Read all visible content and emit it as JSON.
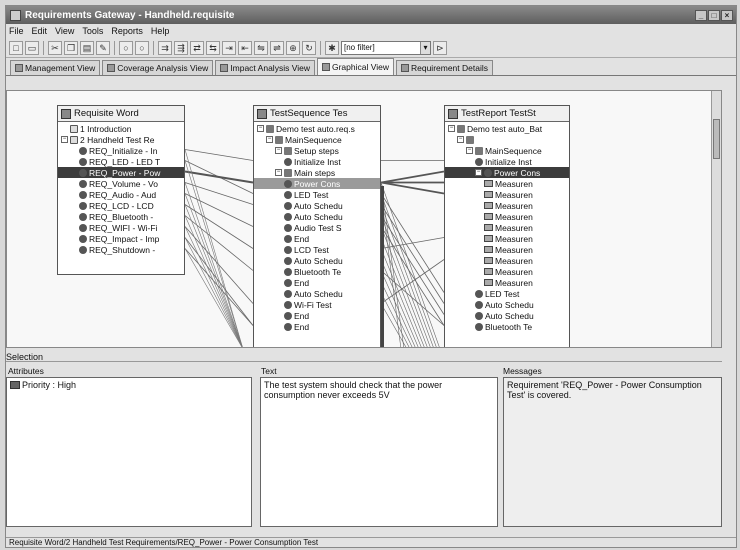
{
  "window": {
    "title": "Requirements Gateway - Handheld.requisite",
    "controls": [
      "_",
      "□",
      "×"
    ]
  },
  "menu": [
    "File",
    "Edit",
    "View",
    "Tools",
    "Reports",
    "Help"
  ],
  "toolbar": {
    "filter_value": "[no filter]"
  },
  "tabs": [
    {
      "label": "Management View"
    },
    {
      "label": "Coverage Analysis View"
    },
    {
      "label": "Impact Analysis View"
    },
    {
      "label": "Graphical View"
    },
    {
      "label": "Requirement Details"
    }
  ],
  "panels": {
    "requisite": {
      "header": "Requisite   Word",
      "rows": [
        {
          "label": "1 Introduction",
          "indent": 1,
          "icon": "doc",
          "state": ""
        },
        {
          "label": "2 Handheld Test Re",
          "indent": 0,
          "icon": "doc",
          "state": "",
          "expander": "⊟"
        },
        {
          "label": "REQ_Initialize - In",
          "indent": 2,
          "icon": "gear",
          "state": ""
        },
        {
          "label": "REQ_LED - LED T",
          "indent": 2,
          "icon": "gear",
          "state": ""
        },
        {
          "label": "REQ_Power - Pow",
          "indent": 2,
          "icon": "gear",
          "state": "sel"
        },
        {
          "label": "REQ_Volume - Vo",
          "indent": 2,
          "icon": "gear",
          "state": ""
        },
        {
          "label": "REQ_Audio - Aud",
          "indent": 2,
          "icon": "gear",
          "state": ""
        },
        {
          "label": "REQ_LCD - LCD",
          "indent": 2,
          "icon": "gear",
          "state": ""
        },
        {
          "label": "REQ_Bluetooth -",
          "indent": 2,
          "icon": "gear",
          "state": ""
        },
        {
          "label": "REQ_WIFI - Wi-Fi",
          "indent": 2,
          "icon": "gear",
          "state": ""
        },
        {
          "label": "REQ_Impact - Imp",
          "indent": 2,
          "icon": "gear",
          "state": ""
        },
        {
          "label": "REQ_Shutdown -",
          "indent": 2,
          "icon": "gear",
          "state": ""
        }
      ]
    },
    "testsequence": {
      "header": "TestSequence   Tes",
      "rows": [
        {
          "label": "Demo test auto.req.s",
          "indent": 0,
          "icon": "fold",
          "state": "",
          "expander": "⊟"
        },
        {
          "label": "MainSequence",
          "indent": 1,
          "icon": "fold",
          "state": "",
          "expander": "⊟"
        },
        {
          "label": "Setup steps",
          "indent": 2,
          "icon": "fold",
          "state": "",
          "expander": "⊟"
        },
        {
          "label": "Initialize Inst",
          "indent": 3,
          "icon": "gear",
          "state": ""
        },
        {
          "label": "Main steps",
          "indent": 2,
          "icon": "fold",
          "state": "",
          "expander": "⊟"
        },
        {
          "label": "Power Cons",
          "indent": 3,
          "icon": "gear",
          "state": "hl"
        },
        {
          "label": "LED Test",
          "indent": 3,
          "icon": "gear",
          "state": ""
        },
        {
          "label": "Auto Schedu",
          "indent": 3,
          "icon": "gear",
          "state": ""
        },
        {
          "label": "Auto Schedu",
          "indent": 3,
          "icon": "gear",
          "state": ""
        },
        {
          "label": "Audio Test S",
          "indent": 3,
          "icon": "gear",
          "state": ""
        },
        {
          "label": "End",
          "indent": 3,
          "icon": "gear",
          "state": ""
        },
        {
          "label": "LCD Test",
          "indent": 3,
          "icon": "gear",
          "state": ""
        },
        {
          "label": "Auto Schedu",
          "indent": 3,
          "icon": "gear",
          "state": ""
        },
        {
          "label": "Bluetooth Te",
          "indent": 3,
          "icon": "gear",
          "state": ""
        },
        {
          "label": "End",
          "indent": 3,
          "icon": "gear",
          "state": ""
        },
        {
          "label": "Auto Schedu",
          "indent": 3,
          "icon": "gear",
          "state": ""
        },
        {
          "label": "Wi-Fi Test",
          "indent": 3,
          "icon": "gear",
          "state": ""
        },
        {
          "label": "End",
          "indent": 3,
          "icon": "gear",
          "state": ""
        },
        {
          "label": "End",
          "indent": 3,
          "icon": "gear",
          "state": ""
        }
      ]
    },
    "testreport": {
      "header": "TestReport   TestSt",
      "rows": [
        {
          "label": "Demo test auto_Bat",
          "indent": 0,
          "icon": "fold",
          "state": "",
          "expander": "⊟"
        },
        {
          "label": "",
          "indent": 1,
          "icon": "fold",
          "state": "",
          "expander": "⊟"
        },
        {
          "label": "MainSequence",
          "indent": 2,
          "icon": "fold",
          "state": "",
          "expander": "⊟"
        },
        {
          "label": "Initialize Inst",
          "indent": 3,
          "icon": "gear",
          "state": ""
        },
        {
          "label": "Power Cons",
          "indent": 3,
          "icon": "gear",
          "state": "sel",
          "expander": "⊟"
        },
        {
          "label": "Measuren",
          "indent": 4,
          "icon": "meas",
          "state": ""
        },
        {
          "label": "Measuren",
          "indent": 4,
          "icon": "meas",
          "state": ""
        },
        {
          "label": "Measuren",
          "indent": 4,
          "icon": "meas",
          "state": ""
        },
        {
          "label": "Measuren",
          "indent": 4,
          "icon": "meas",
          "state": ""
        },
        {
          "label": "Measuren",
          "indent": 4,
          "icon": "meas",
          "state": ""
        },
        {
          "label": "Measuren",
          "indent": 4,
          "icon": "meas",
          "state": ""
        },
        {
          "label": "Measuren",
          "indent": 4,
          "icon": "meas",
          "state": ""
        },
        {
          "label": "Measuren",
          "indent": 4,
          "icon": "meas",
          "state": ""
        },
        {
          "label": "Measuren",
          "indent": 4,
          "icon": "meas",
          "state": ""
        },
        {
          "label": "Measuren",
          "indent": 4,
          "icon": "meas",
          "state": ""
        },
        {
          "label": "LED Test",
          "indent": 3,
          "icon": "gear",
          "state": ""
        },
        {
          "label": "Auto Schedu",
          "indent": 3,
          "icon": "gear",
          "state": ""
        },
        {
          "label": "Auto Schedu",
          "indent": 3,
          "icon": "gear",
          "state": ""
        },
        {
          "label": "Bluetooth Te",
          "indent": 3,
          "icon": "gear",
          "state": ""
        }
      ]
    }
  },
  "selection": {
    "title": "Selection",
    "attributes_label": "Attributes",
    "attribute_value": "Priority : High",
    "text_label": "Text",
    "text_value": "The test system should check that the power consumption never exceeds 5V",
    "messages_label": "Messages",
    "messages_value": "Requirement 'REQ_Power - Power Consumption Test' is covered."
  },
  "status": {
    "text": "Requisite   Word/2 Handheld Test Requirements/REQ_Power - Power Consumption Test"
  }
}
